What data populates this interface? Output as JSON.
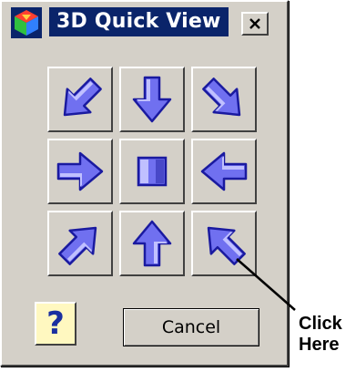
{
  "window": {
    "title": "3D Quick View",
    "title_bar_color": "#0a246a",
    "app_icon": "3d-cube-icon",
    "close_icon": "close-icon"
  },
  "view_buttons": [
    {
      "icon": "arrow-down-right-icon"
    },
    {
      "icon": "arrow-down-icon"
    },
    {
      "icon": "arrow-down-left-icon"
    },
    {
      "icon": "arrow-right-icon"
    },
    {
      "icon": "front-view-square-icon"
    },
    {
      "icon": "arrow-left-icon"
    },
    {
      "icon": "arrow-up-right-icon"
    },
    {
      "icon": "arrow-up-icon"
    },
    {
      "icon": "arrow-up-left-icon"
    }
  ],
  "help": {
    "label": "?",
    "icon": "help-question-icon"
  },
  "cancel": {
    "label": "Cancel"
  },
  "annotation": {
    "line1": "Click",
    "line2": "Here"
  },
  "colors": {
    "arrow_fill": "#7070f0",
    "arrow_dark": "#1a1aa0",
    "arrow_light": "#b8b8ff",
    "dialog_bg": "#d4d0c8"
  }
}
